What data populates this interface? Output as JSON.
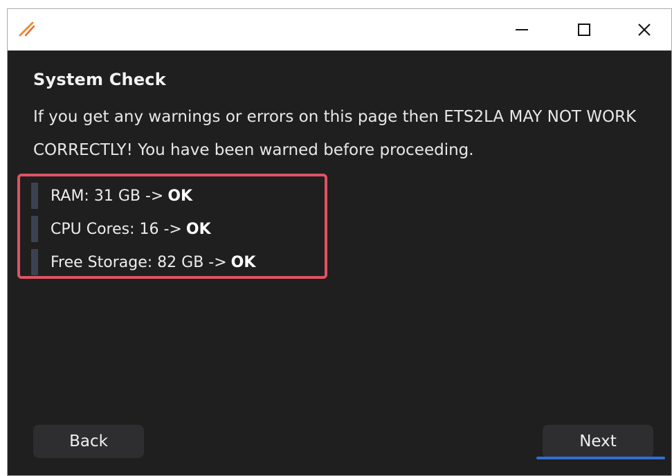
{
  "window": {
    "controls": {
      "minimize": "minimize-icon",
      "maximize": "maximize-icon",
      "close": "close-icon"
    },
    "accent_color": "#2f6fd6",
    "highlight_color": "#e05263"
  },
  "page": {
    "title": "System Check",
    "warning": "If you get any warnings or errors on this page then ETS2LA MAY NOT WORK CORRECTLY! You have been warned before proceeding."
  },
  "checks": [
    {
      "label": "RAM: 31 GB ->",
      "status": "OK"
    },
    {
      "label": "CPU Cores: 16 ->",
      "status": "OK"
    },
    {
      "label": "Free Storage: 82 GB ->",
      "status": "OK"
    }
  ],
  "buttons": {
    "back": "Back",
    "next": "Next"
  }
}
